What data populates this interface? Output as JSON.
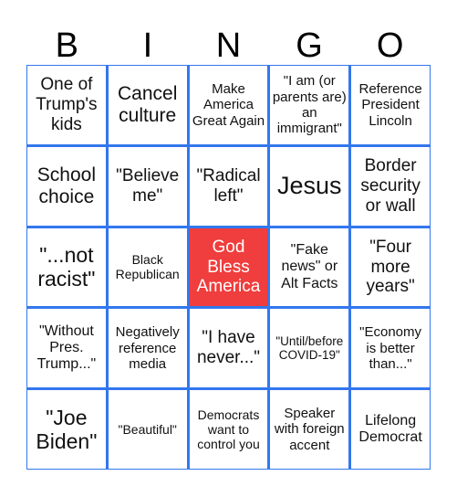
{
  "header": [
    "B",
    "I",
    "N",
    "G",
    "O"
  ],
  "colors": {
    "grid_border": "#3377ee",
    "free_space": "#f03d3d"
  },
  "cells": [
    [
      "One of Trump's kids",
      "Cancel culture",
      "Make America Great Again",
      "\"I am (or parents are) an immigrant\"",
      "Reference President Lincoln"
    ],
    [
      "School choice",
      "\"Believe me\"",
      "\"Radical left\"",
      "Jesus",
      "Border security or wall"
    ],
    [
      "\"...not racist\"",
      "Black Republican",
      "God Bless America",
      "\"Fake news\" or Alt Facts",
      "\"Four more years\""
    ],
    [
      "\"Without Pres. Trump...\"",
      "Negatively reference media",
      "\"I have never...\"",
      "\"Until/before COVID-19\"",
      "\"Economy is better than...\""
    ],
    [
      "\"Joe Biden\"",
      "\"Beautiful\"",
      "Democrats want to control you",
      "Speaker with foreign accent",
      "Lifelong Democrat"
    ]
  ]
}
